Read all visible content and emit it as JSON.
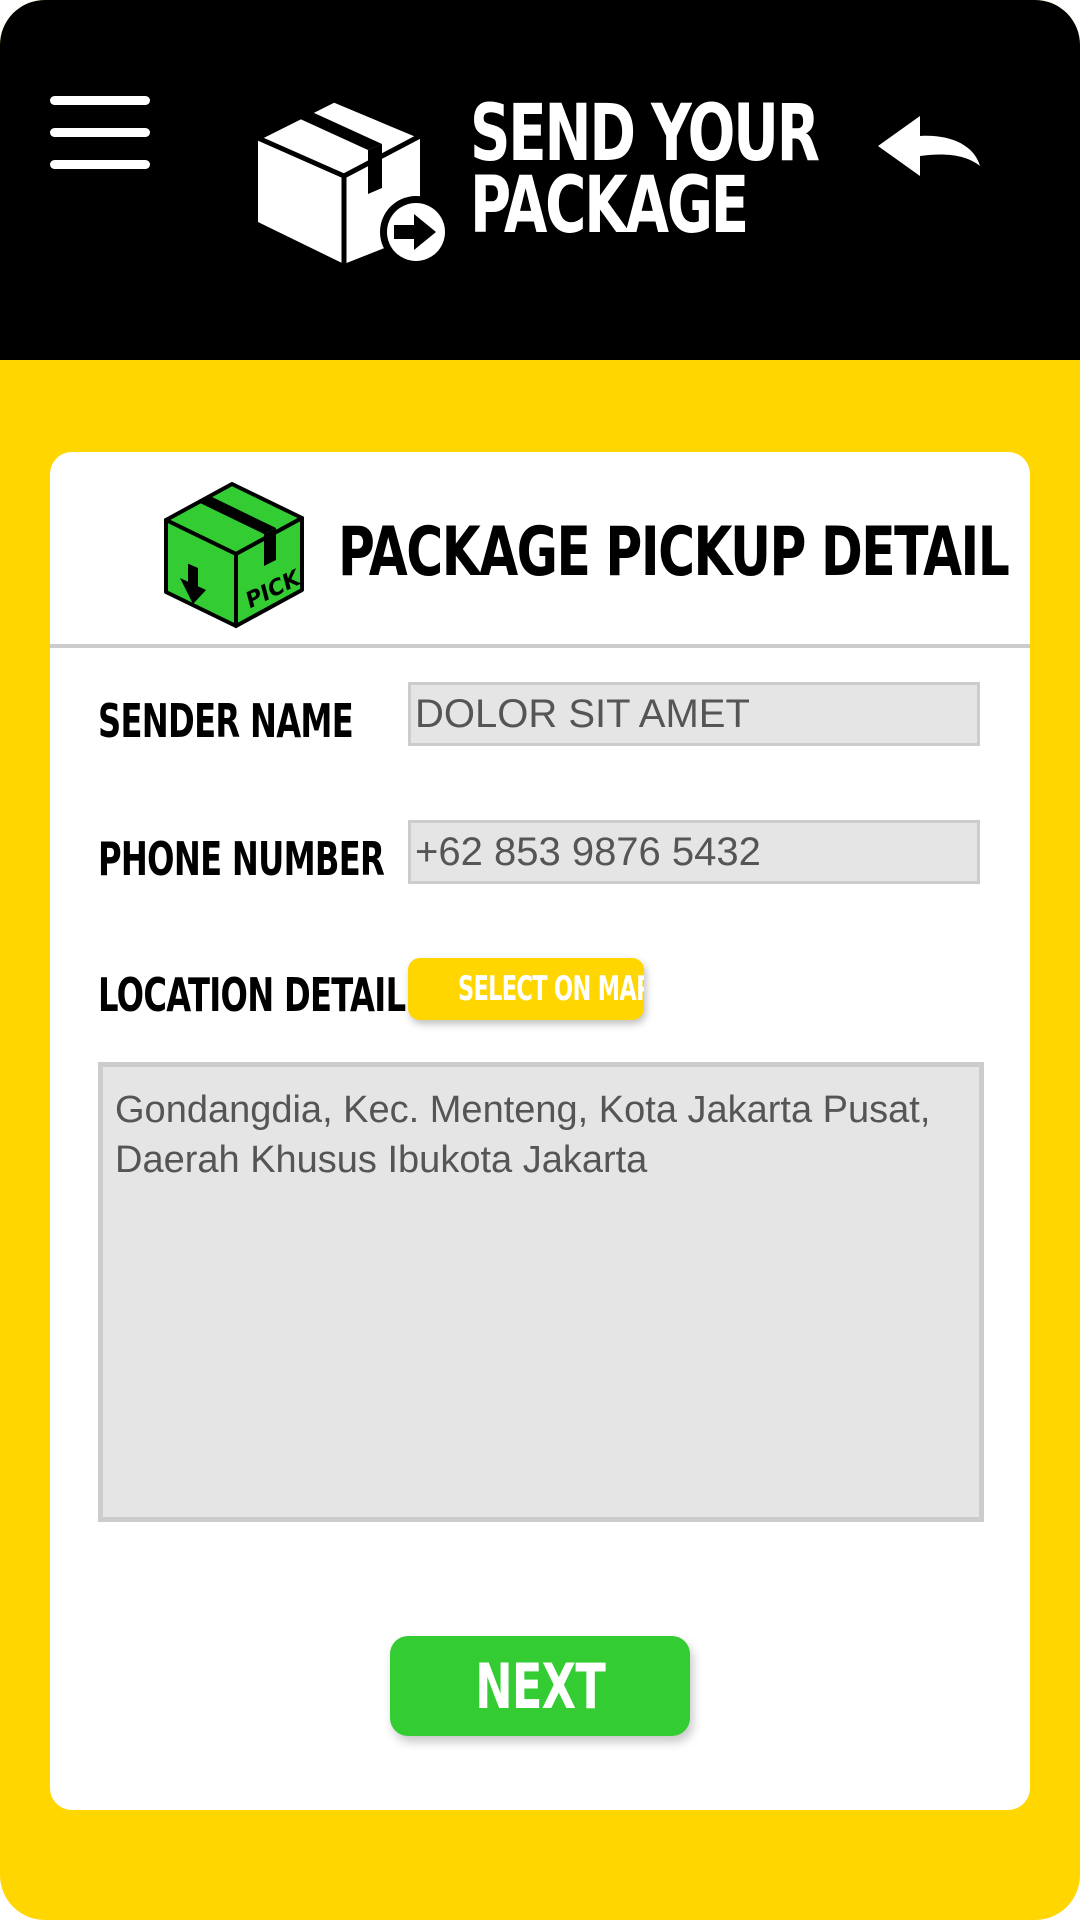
{
  "header": {
    "title_line1": "SEND YOUR",
    "title_line2": "PACKAGE",
    "menu_icon": "hamburger-menu-icon",
    "back_icon": "back-arrow-icon",
    "logo_icon": "package-send-icon",
    "background_color": "#000000"
  },
  "form": {
    "title": "PACKAGE PICKUP DETAIL",
    "title_icon": "package-pick-icon",
    "title_icon_text": "PICK",
    "sender_name_label": "SENDER NAME",
    "sender_name_value": "DOLOR SIT AMET",
    "phone_label": "PHONE NUMBER",
    "phone_value": "+62 853 9876 5432",
    "location_label": "LOCATION DETAIL",
    "select_map_label": "SELECT ON MAP",
    "location_value": "Gondangdia, Kec. Menteng, Kota Jakarta Pusat, Daerah Khusus Ibukota Jakarta",
    "next_label": "NEXT"
  },
  "colors": {
    "accent_yellow": "#FFD600",
    "primary_green": "#33CC33",
    "icon_green": "#33CC33",
    "input_bg": "#E5E5E5"
  }
}
